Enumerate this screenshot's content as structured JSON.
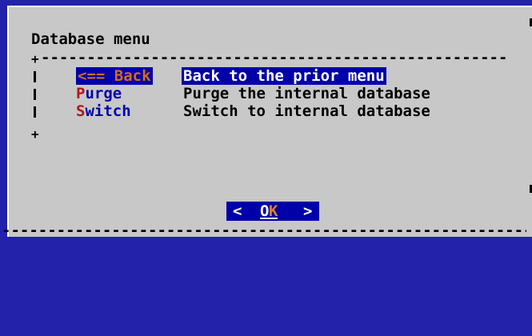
{
  "dialog": {
    "title": "Database menu",
    "menu_items": [
      {
        "tag": "<== Back",
        "description": "Back to the prior menu",
        "selected": true
      },
      {
        "tag": "Purge",
        "description": "Purge the internal database",
        "selected": false
      },
      {
        "tag": "Switch",
        "description": "Switch to internal database",
        "selected": false
      }
    ],
    "ok_button": {
      "left_arrow": "<",
      "label_plain": "O",
      "label_hot": "K",
      "right_arrow": ">"
    }
  },
  "colors": {
    "screen_background": "#2222aa",
    "dialog_background": "#c8c8c8",
    "selection_background": "#0000aa",
    "selected_tag": "#d86a1a",
    "tag_red": "#b01818",
    "tag_blue": "#0000aa"
  }
}
